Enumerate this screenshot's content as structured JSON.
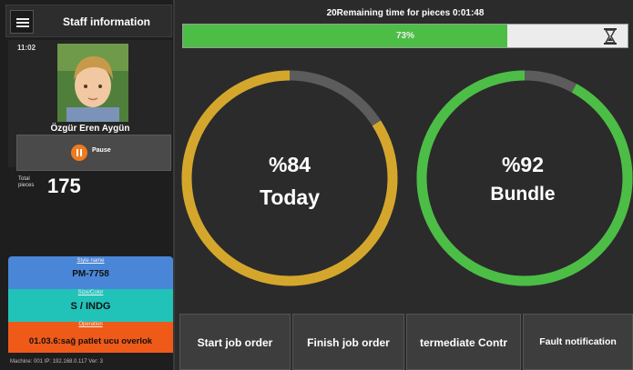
{
  "sidebar": {
    "title": "Staff information",
    "clock": "11:02",
    "name": "Özgür Eren Aygün",
    "pause_label": "Pause",
    "total_label": "Total pieces",
    "total_value": "175",
    "style_caption": "Style name",
    "style_value": "PM-7758",
    "size_caption": "Size/Color",
    "size_value": "S / INDG",
    "operation_caption": "Operation",
    "operation_value": "01.03.6:sağ patlet ucu overlok",
    "machine_info": "Machine: 001   IP: 192.168.0.117   Ver: 3"
  },
  "timer": {
    "text": "20Remaining time for  pieces 0:01:48",
    "progress_label": "73%",
    "progress": 0.73
  },
  "gauges": [
    {
      "percent_text": "%84",
      "label": "Today",
      "value": 0.84,
      "color": "#d4a72c"
    },
    {
      "percent_text": "%92",
      "label": "Bundle",
      "value": 0.92,
      "color": "#4cbe46"
    }
  ],
  "buttons": {
    "start": "Start job order",
    "finish": "Finish job order",
    "intermediate": "termediate Contr",
    "fault": "Fault notification"
  },
  "colors": {
    "track": "#5c5c5c",
    "style_box": "#4a86d8",
    "size_box": "#21c3b9",
    "operation_box": "#ef5a19",
    "progress_fill": "#4cbe46",
    "pause": "#f07a1e"
  }
}
